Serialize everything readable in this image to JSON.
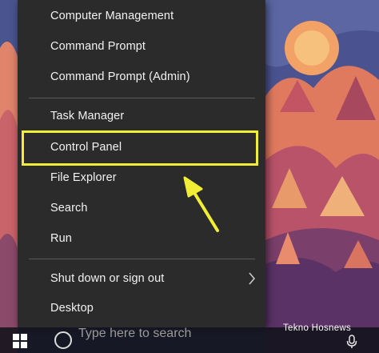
{
  "menu": {
    "items": [
      {
        "label": "Computer Management"
      },
      {
        "label": "Command Prompt"
      },
      {
        "label": "Command Prompt (Admin)"
      },
      {
        "label": "Task Manager"
      },
      {
        "label": "Control Panel"
      },
      {
        "label": "File Explorer"
      },
      {
        "label": "Search"
      },
      {
        "label": "Run"
      },
      {
        "label": "Shut down or sign out"
      },
      {
        "label": "Desktop"
      }
    ],
    "highlighted_item": "Control Panel",
    "highlight_color": "#f2ee35"
  },
  "taskbar": {
    "search_placeholder": "Type here to search"
  },
  "watermark": {
    "text": "Tekno Hosnews"
  },
  "icons": {
    "start": "windows-logo-icon",
    "search": "cortana-circle-icon",
    "submenu": "chevron-right-icon",
    "pointer": "arrow-pointer-icon",
    "mic": "microphone-icon"
  }
}
